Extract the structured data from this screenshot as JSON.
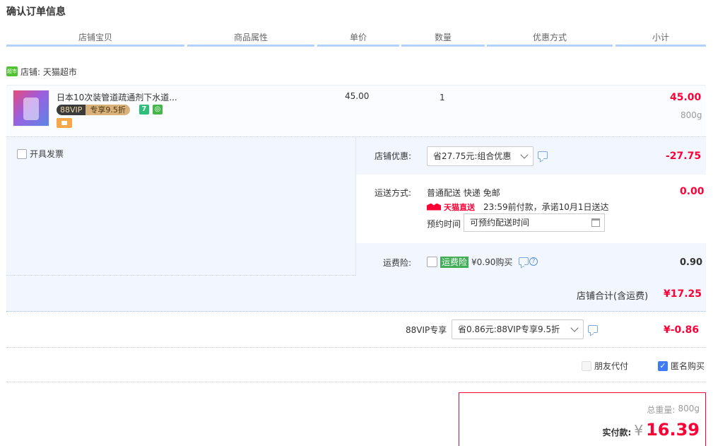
{
  "page_title": "确认订单信息",
  "columns": [
    "店铺宝贝",
    "商品属性",
    "单价",
    "数量",
    "优惠方式",
    "小计"
  ],
  "shop": {
    "icon_text": "超市",
    "label": "店铺: 天猫超市"
  },
  "item": {
    "name": "日本10次装管道疏通剂下水道...",
    "vip_left": "88VIP",
    "vip_right": "专享9.5折",
    "badge7": "7",
    "price": "45.00",
    "quantity": "1",
    "subtotal": "45.00",
    "weight": "800g"
  },
  "invoice": {
    "label": "开具发票"
  },
  "shop_discount": {
    "label": "店铺优惠:",
    "selected": "省27.75元:组合优惠",
    "amount": "-27.75"
  },
  "delivery": {
    "label": "运送方式:",
    "method": "普通配送 快递 免邮",
    "direct_badge": "天猫直送",
    "promise": "23:59前付款，承诺10月1日送达",
    "schedule_label": "预约时间",
    "schedule_placeholder": "可预约配送时间",
    "amount": "0.00"
  },
  "insurance": {
    "label": "运费险:",
    "tag": "运费险",
    "desc": "¥0.90购买",
    "amount": "0.90"
  },
  "shop_total": {
    "label": "店铺合计(含运费)",
    "amount": "¥17.25"
  },
  "vip": {
    "label": "88VIP专享",
    "selected": "省0.86元:88VIP专享9.5折",
    "amount": "¥-0.86"
  },
  "options": {
    "friend_pay": "朋友代付",
    "anonymous": "匿名购买"
  },
  "payment": {
    "weight_label": "总重量:",
    "weight": "800g",
    "pay_label": "实付款:",
    "currency": "¥",
    "amount": "16.39"
  },
  "colors": {
    "accent_red": "#ff0036",
    "header_blue": "#b2d1ff",
    "panel_blue": "#f2f7ff"
  }
}
